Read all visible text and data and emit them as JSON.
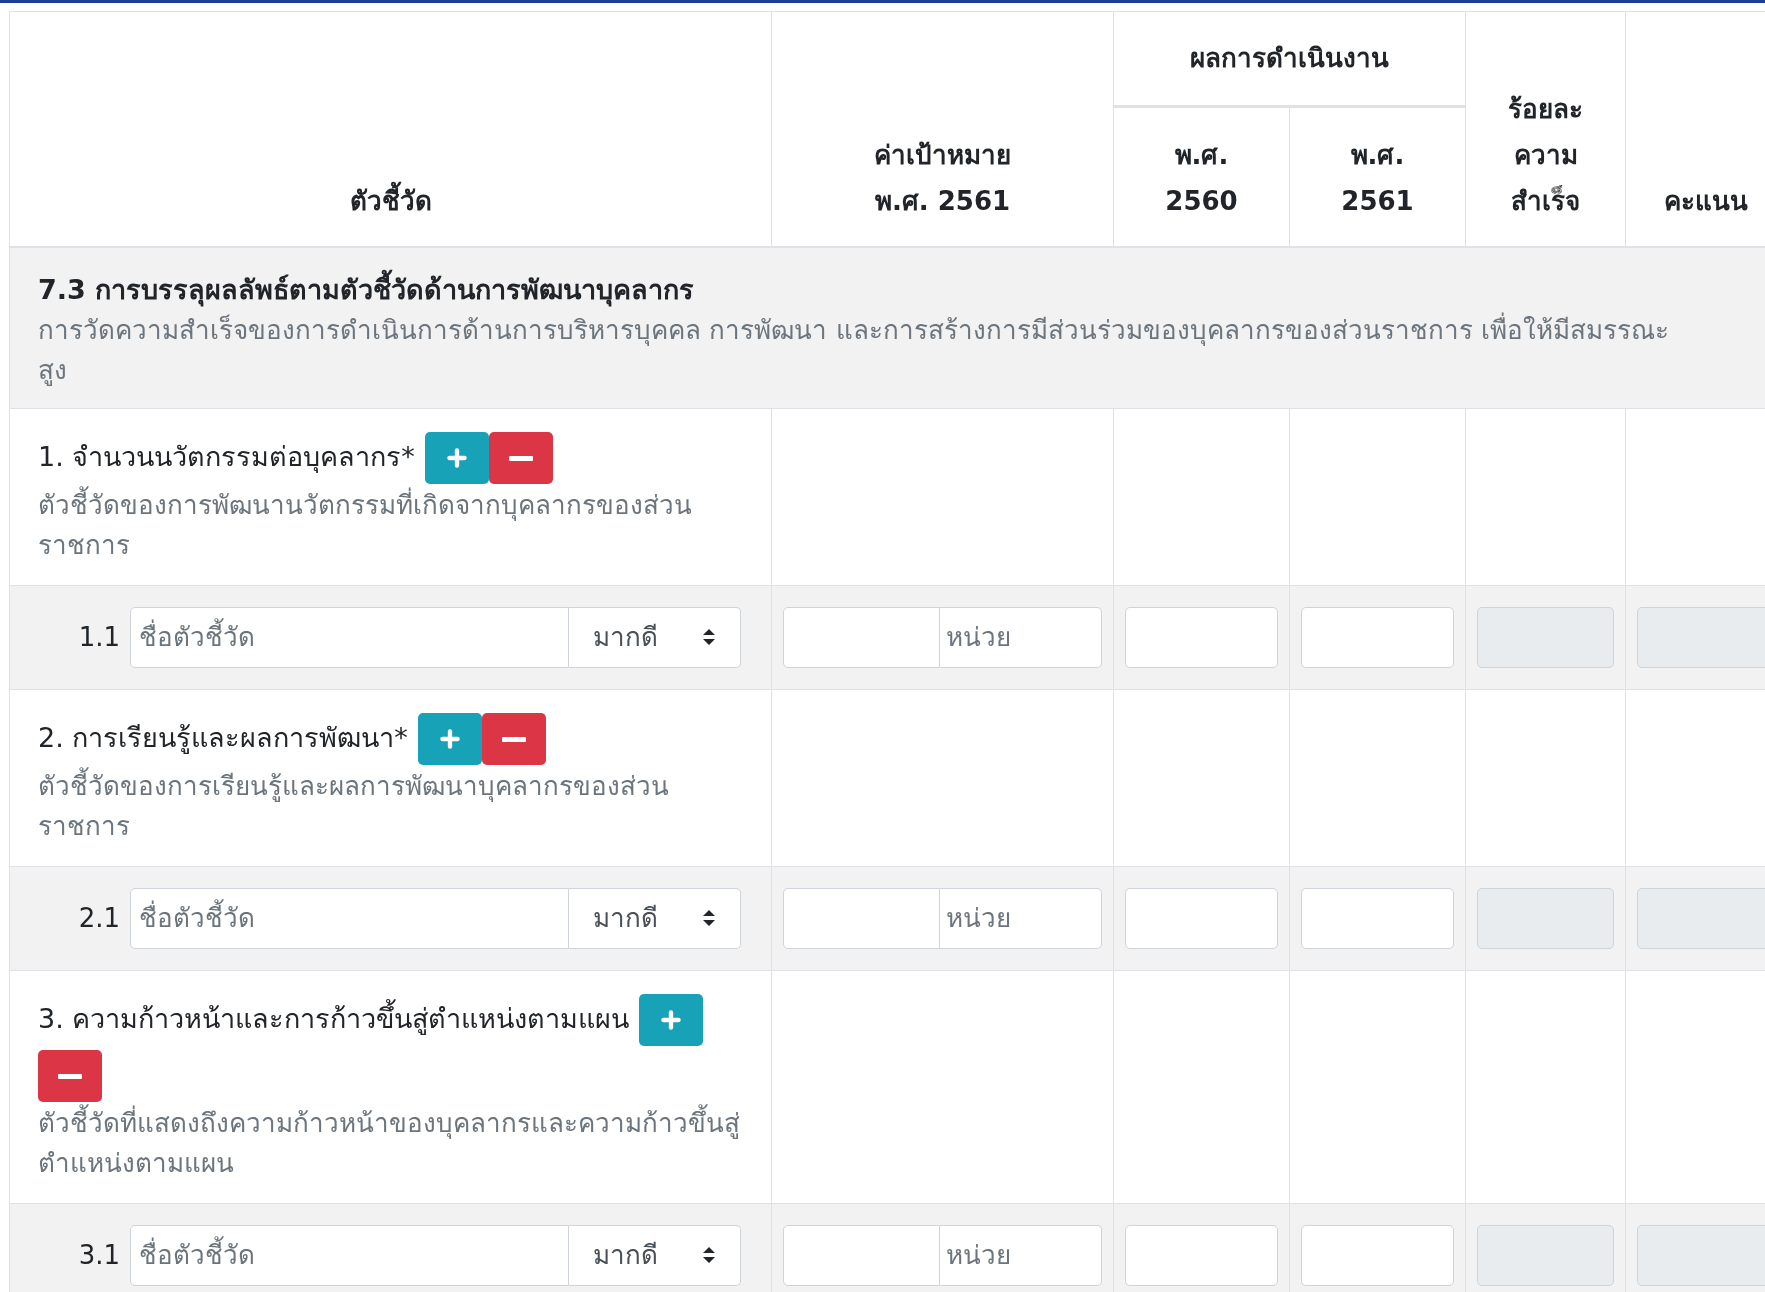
{
  "table": {
    "columns": [
      {
        "kind": "single",
        "lines": [
          "ตัวชี้วัด"
        ]
      },
      {
        "kind": "single",
        "lines": [
          "ค่าเป้าหมาย",
          "พ.ศ. 2561"
        ]
      },
      {
        "kind": "group",
        "label": "ผลการดำเนินงาน",
        "children": [
          {
            "lines": [
              "พ.ศ.",
              "2560"
            ]
          },
          {
            "lines": [
              "พ.ศ.",
              "2561"
            ]
          }
        ]
      },
      {
        "kind": "single",
        "lines": [
          "ร้อยละ",
          "ความ",
          "สำเร็จ"
        ]
      },
      {
        "kind": "single",
        "lines": [
          "คะแนน"
        ]
      }
    ],
    "section": {
      "title": "7.3 การบรรลุผลลัพธ์ตามตัวชี้วัดด้านการพัฒนาบุคลากร",
      "description": "การวัดความสำเร็จของการดำเนินการด้านการบริหารบุคคล การพัฒนา และการสร้างการมีส่วนร่วมของบุคลากรของส่วนราชการ เพื่อให้มีสมรรณะสูง"
    },
    "indicators": [
      {
        "title": "1. จำนวนนวัตกรรมต่อบุคลากร*",
        "buttons": [
          {
            "kind": "add"
          },
          {
            "kind": "remove"
          }
        ],
        "description": "ตัวชี้วัดของการพัฒนานวัตกรรมที่เกิดจากบุคลากรของส่วนราชการ",
        "sub": {
          "number": "1.1",
          "name_placeholder": "ชื่อตัวชี้วัด",
          "select_value": "มากดี",
          "unit_placeholder": "หน่วย",
          "percent_disabled": true,
          "score_disabled": true
        }
      },
      {
        "title": "2. การเรียนรู้และผลการพัฒนา*",
        "buttons": [
          {
            "kind": "add"
          },
          {
            "kind": "remove"
          }
        ],
        "description": "ตัวชี้วัดของการเรียนรู้และผลการพัฒนาบุคลากรของส่วนราชการ",
        "sub": {
          "number": "2.1",
          "name_placeholder": "ชื่อตัวชี้วัด",
          "select_value": "มากดี",
          "unit_placeholder": "หน่วย",
          "percent_disabled": true,
          "score_disabled": true
        }
      },
      {
        "title": "3. ความก้าวหน้าและการก้าวขึ้นสู่ตำแหน่งตามแผน",
        "buttons": [
          {
            "kind": "add"
          },
          {
            "kind": "remove"
          }
        ],
        "description": "ตัวชี้วัดที่แสดงถึงความก้าวหน้าของบุคลากรและความก้าวขึ้นสู่ตำแหน่งตามแผน",
        "sub": {
          "number": "3.1",
          "name_placeholder": "ชื่อตัวชี้วัด",
          "select_value": "มากดี",
          "unit_placeholder": "หน่วย",
          "percent_disabled": true,
          "score_disabled": true
        }
      }
    ]
  }
}
